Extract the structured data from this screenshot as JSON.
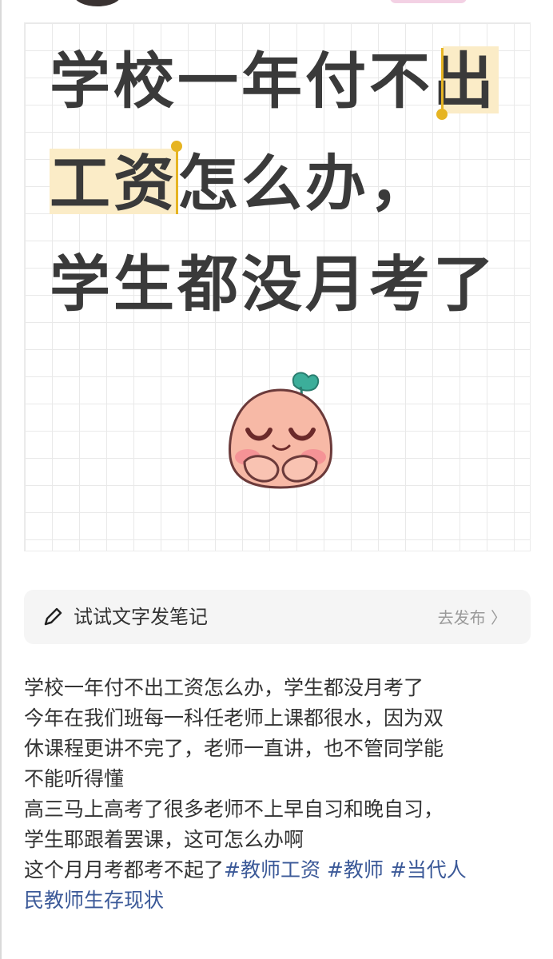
{
  "note": {
    "title_lines": [
      "学校一年付不",
      "出",
      "工资",
      "怎么办，",
      "学生都没月考了"
    ],
    "highlight_color": "#fbecc7",
    "cursor_color": "#e6b422"
  },
  "composer": {
    "icon": "pencil-icon",
    "hint": "试试文字发笔记",
    "publish_label": "去发布 〉"
  },
  "post": {
    "lines": [
      "学校一年付不出工资怎么办，学生都没月考了",
      "今年在我们班每一科任老师上课都很水，因为双",
      "休课程更讲不完了，老师一直讲，也不管同学能",
      "不能听得懂",
      "高三马上高考了很多老师不上早自习和晚自习，",
      "学生耶跟着罢课，这可怎么办啊",
      "这个月月考都考不起了"
    ],
    "tail_line": "民教师生存现状",
    "tags": [
      "#教师工资",
      "#教师",
      "#当代人"
    ],
    "tag_color": "#3b5998"
  }
}
